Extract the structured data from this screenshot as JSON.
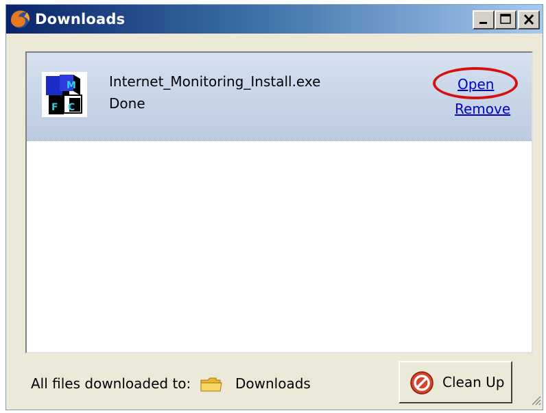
{
  "window": {
    "title": "Downloads",
    "icon": "firefox-icon",
    "controls": [
      "minimize-icon",
      "maximize-icon",
      "close-icon"
    ]
  },
  "download": {
    "filename": "Internet_Monitoring_Install.exe",
    "status": "Done",
    "icon": "application-icon",
    "open_label": "Open",
    "remove_label": "Remove"
  },
  "footer": {
    "label": "All files downloaded to:",
    "folder_icon": "folder-icon",
    "folder_name": "Downloads",
    "cleanup_icon": "no-entry-icon",
    "cleanup_label": "Clean Up"
  },
  "colors": {
    "title_bar": "#0a246a",
    "item_background": "#c9d7ea",
    "link": "#0000cc",
    "highlight": "#d61010"
  }
}
